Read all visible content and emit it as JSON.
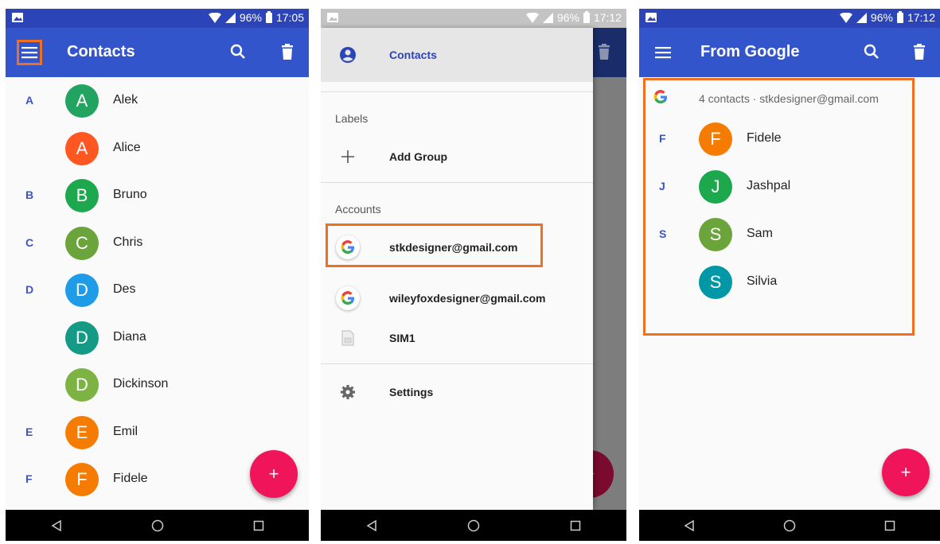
{
  "status_left": {
    "battery": "96%",
    "time": "17:05"
  },
  "status_mid": {
    "battery": "96%",
    "time": "17:12"
  },
  "status_right": {
    "battery": "96%",
    "time": "17:12"
  },
  "screen1": {
    "title": "Contacts",
    "rows": [
      {
        "letter": "A",
        "initial": "A",
        "name": "Alek",
        "color": "#23a360"
      },
      {
        "letter": "",
        "initial": "A",
        "name": "Alice",
        "color": "#ff5722"
      },
      {
        "letter": "B",
        "initial": "B",
        "name": "Bruno",
        "color": "#1ea84e"
      },
      {
        "letter": "C",
        "initial": "C",
        "name": "Chris",
        "color": "#6aa43a"
      },
      {
        "letter": "D",
        "initial": "D",
        "name": "Des",
        "color": "#1e9ce8"
      },
      {
        "letter": "",
        "initial": "D",
        "name": "Diana",
        "color": "#159a86"
      },
      {
        "letter": "",
        "initial": "D",
        "name": "Dickinson",
        "color": "#7cb342"
      },
      {
        "letter": "E",
        "initial": "E",
        "name": "Emil",
        "color": "#f57c00"
      },
      {
        "letter": "F",
        "initial": "F",
        "name": "Fidele",
        "color": "#f57c00"
      }
    ],
    "fab_label": "+"
  },
  "screen2": {
    "contacts_label": "Contacts",
    "labels_heading": "Labels",
    "add_group_label": "Add Group",
    "accounts_heading": "Accounts",
    "account_1": "stkdesigner@gmail.com",
    "account_2": "wileyfoxdesigner@gmail.com",
    "sim_label": "SIM1",
    "settings_label": "Settings",
    "fab_label": "+"
  },
  "screen3": {
    "title": "From Google",
    "account_summary": "4 contacts · stkdesigner@gmail.com",
    "rows": [
      {
        "letter": "F",
        "initial": "F",
        "name": "Fidele",
        "color": "#f57c00"
      },
      {
        "letter": "J",
        "initial": "J",
        "name": "Jashpal",
        "color": "#1ea84e"
      },
      {
        "letter": "S",
        "initial": "S",
        "name": "Sam",
        "color": "#6aa43a"
      },
      {
        "letter": "",
        "initial": "S",
        "name": "Silvia",
        "color": "#0097a7"
      }
    ],
    "fab_label": "+"
  },
  "colors": {
    "appbar": "#3355cc",
    "statusbar": "#2b44b8",
    "highlight": "#f07020",
    "fab": "#f0145a",
    "section_letter": "#3a55c8"
  }
}
